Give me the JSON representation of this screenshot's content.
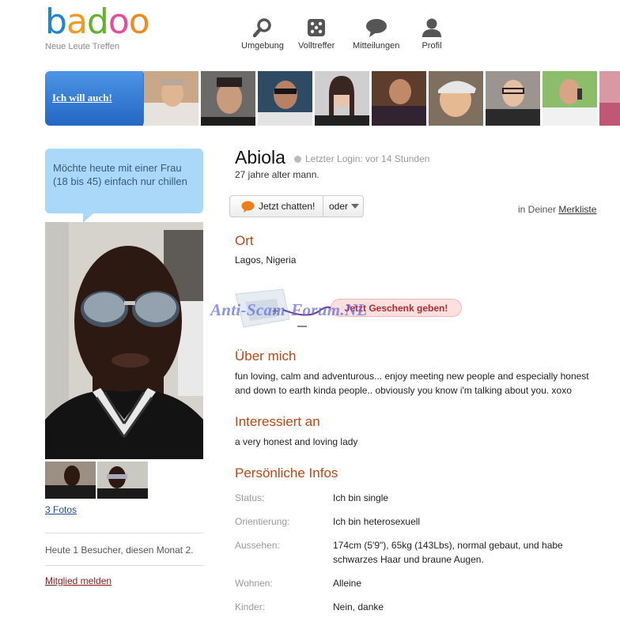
{
  "header": {
    "logo": [
      "b",
      "a",
      "d",
      "o",
      "o"
    ],
    "tagline": "Neue Leute Treffen",
    "nav": [
      {
        "label": "Umgebung",
        "icon": "search-icon"
      },
      {
        "label": "Volltreffer",
        "icon": "dice-icon"
      },
      {
        "label": "Mitteilungen",
        "icon": "chat-bubble-icon"
      },
      {
        "label": "Profil",
        "icon": "user-icon"
      }
    ]
  },
  "banner": {
    "cta": "Ich will auch!"
  },
  "left": {
    "status_bubble": "Möchte heute mit einer Frau (18 bis 45) einfach nur chillen",
    "photos_link": "3 Fotos",
    "visits": "Heute 1 Besucher, diesen Monat 2.",
    "report": "Mitglied melden"
  },
  "profile": {
    "name": "Abiola",
    "last_login": "Letzter Login: vor 14 Stunden",
    "age": "27 jahre alter mann.",
    "chat_button": "Jetzt chatten!",
    "or_button": "oder",
    "merk_prefix": "in Deiner",
    "merk_link": "Merkliste",
    "ort_heading": "Ort",
    "ort": "Lagos, Nigeria",
    "gift_button": "Jetzt Geschenk geben!",
    "watermark": "Anti-Scam-Forum.NL",
    "about_heading": "Über mich",
    "about_line1": "fun loving, calm and adventurous... enjoy meeting new people and especially honest",
    "about_line2": "and down to earth kinda people.. obviously you know i'm talking about you. xoxo",
    "interest_heading": "Interessiert an",
    "interest": "a very honest and loving lady",
    "info_heading": "Persönliche Infos",
    "info": [
      {
        "k": "Status:",
        "v": "Ich bin single"
      },
      {
        "k": "Orientierung:",
        "v": "Ich bin heterosexuell"
      },
      {
        "k": "Aussehen:",
        "v": "174cm (5'9\"), 65kg (143Lbs), normal gebaut, und habe",
        "v2": "schwarzes Haar und braune Augen."
      },
      {
        "k": "Wohnen:",
        "v": "Alleine"
      },
      {
        "k": "Kinder:",
        "v": "Nein, danke"
      }
    ]
  },
  "colors": {
    "heading": "#c04510",
    "link": "#1d4f91",
    "banner": "#2f7fd6",
    "bubble": "#a9d8f8"
  }
}
